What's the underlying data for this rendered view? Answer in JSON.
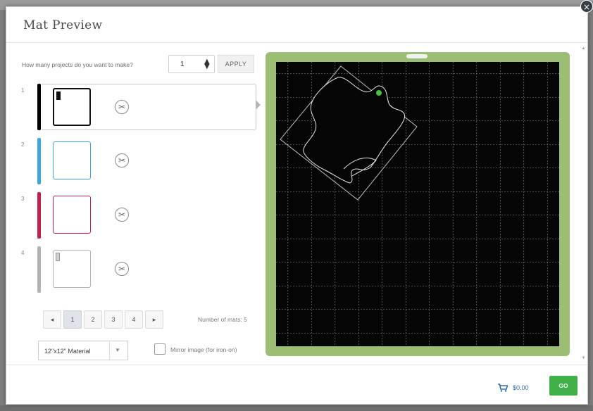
{
  "dialog": {
    "title": "Mat Preview",
    "close_icon": "close-icon"
  },
  "quantity": {
    "label": "How many projects do you want to make?",
    "value": "1",
    "apply_label": "APPLY"
  },
  "mats": [
    {
      "number": "1",
      "color": "#000000",
      "selected": true,
      "has_design": true
    },
    {
      "number": "2",
      "color": "#3ba6dd",
      "selected": false,
      "has_design": false
    },
    {
      "number": "3",
      "color": "#c0224a",
      "selected": false,
      "has_design": false
    },
    {
      "number": "4",
      "color": "#b2b2b2",
      "selected": false,
      "has_design": true
    }
  ],
  "pagination": {
    "prev_icon": "chevron-left-icon",
    "pages": [
      "1",
      "2",
      "3",
      "4"
    ],
    "active_page": "1",
    "next_icon": "chevron-right-icon",
    "mats_count_label": "Number of mats: 5"
  },
  "material": {
    "selected": "12\"x12\" Material"
  },
  "mirror": {
    "label": "Mirror image (for iron-on)",
    "checked": false
  },
  "mat_preview": {
    "mat_color": "#9bbd74",
    "board_color": "#050505",
    "grid_color": "#8a8a8a"
  },
  "footer": {
    "price": "$0.00",
    "go_label": "GO",
    "go_color": "#3fb04a"
  }
}
